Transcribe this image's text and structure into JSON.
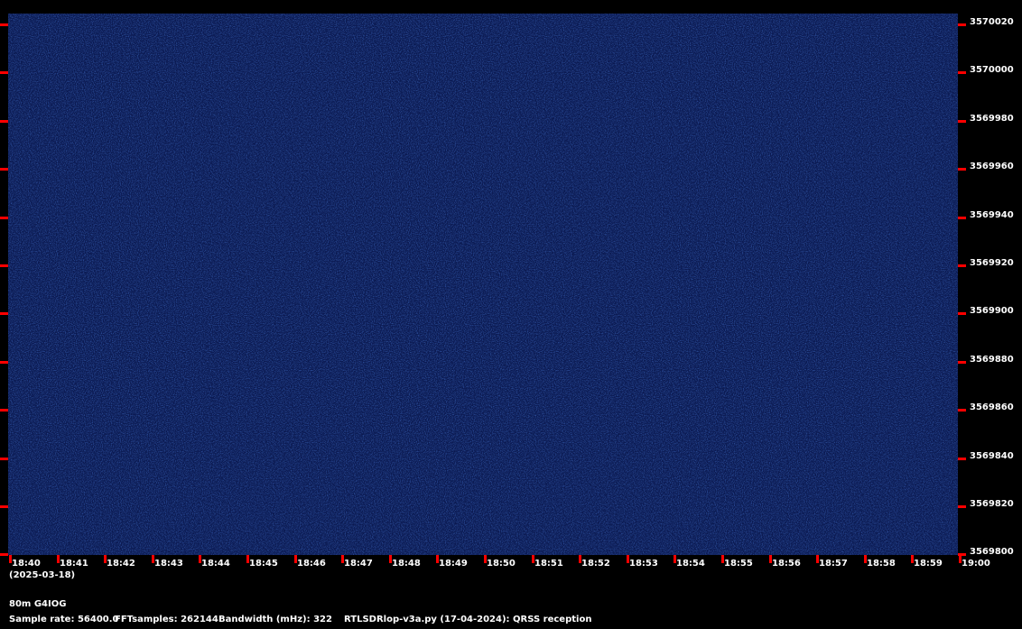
{
  "colors": {
    "background": "#000000",
    "spectrogram": "#0b1a52",
    "tick": "#ff0000",
    "text": "#ffffff"
  },
  "y_axis": {
    "labels": [
      "3570020",
      "3570000",
      "3569980",
      "3569960",
      "3569940",
      "3569920",
      "3569900",
      "3569880",
      "3569860",
      "3569840",
      "3569820",
      "3569800"
    ]
  },
  "x_axis": {
    "labels": [
      "18:40",
      "18:41",
      "18:42",
      "18:43",
      "18:44",
      "18:45",
      "18:46",
      "18:47",
      "18:48",
      "18:49",
      "18:50",
      "18:51",
      "18:52",
      "18:53",
      "18:54",
      "18:55",
      "18:56",
      "18:57",
      "18:58",
      "18:59",
      "19:00"
    ],
    "date": "(2025-03-18)"
  },
  "info": {
    "station": "80m G4IOG",
    "sample_rate": "Sample rate: 56400.0",
    "fft_samples": "FFTsamples: 262144",
    "bandwidth": "Bandwidth (mHz): 322",
    "program": "RTLSDRlop-v3a.py (17-04-2024): QRSS reception"
  }
}
